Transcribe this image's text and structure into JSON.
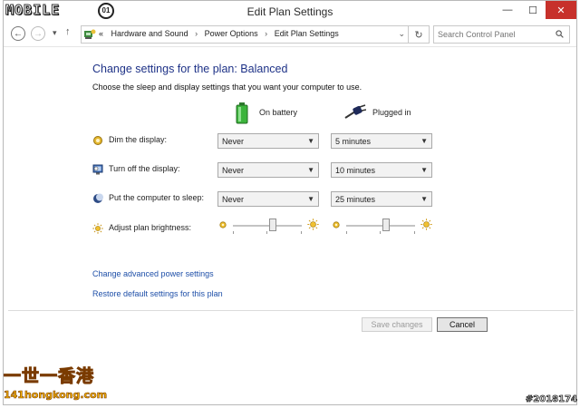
{
  "watermark": {
    "logo": "MOBILE",
    "logo_mark": "01",
    "cn_text": "一世一香港",
    "url": "141hongkong.com",
    "image_id": "#2018174"
  },
  "window": {
    "title": "Edit Plan Settings",
    "minimize": "—",
    "maximize": "☐",
    "close": "✕"
  },
  "nav": {
    "back": "←",
    "forward": "→",
    "recent": "▾",
    "up": "↑",
    "crumb_prefix": "«",
    "breadcrumbs": [
      "Hardware and Sound",
      "Power Options",
      "Edit Plan Settings"
    ],
    "separator": "›",
    "dropdown": "⌄",
    "refresh": "↻",
    "search_placeholder": "Search Control Panel"
  },
  "plan": {
    "heading": "Change settings for the plan: Balanced",
    "subheading": "Choose the sleep and display settings that you want your computer to use.",
    "on_battery": "On battery",
    "plugged_in": "Plugged in",
    "rows": [
      {
        "label": "Dim the display:",
        "battery": "Never",
        "plugged": "5 minutes",
        "icon": "dim-display-icon"
      },
      {
        "label": "Turn off the display:",
        "battery": "Never",
        "plugged": "10 minutes",
        "icon": "monitor-off-icon"
      },
      {
        "label": "Put the computer to sleep:",
        "battery": "Never",
        "plugged": "25 minutes",
        "icon": "sleep-moon-icon"
      }
    ],
    "brightness_label": "Adjust plan brightness:",
    "brightness": {
      "battery": 0.58,
      "plugged": 0.58
    }
  },
  "links": {
    "advanced": "Change advanced power settings",
    "restore": "Restore default settings for this plan"
  },
  "buttons": {
    "save": "Save changes",
    "cancel": "Cancel"
  },
  "colors": {
    "heading": "#1e3287",
    "link": "#1e4fa8",
    "close": "#c7312b",
    "battery_green": "#3cb43c"
  }
}
